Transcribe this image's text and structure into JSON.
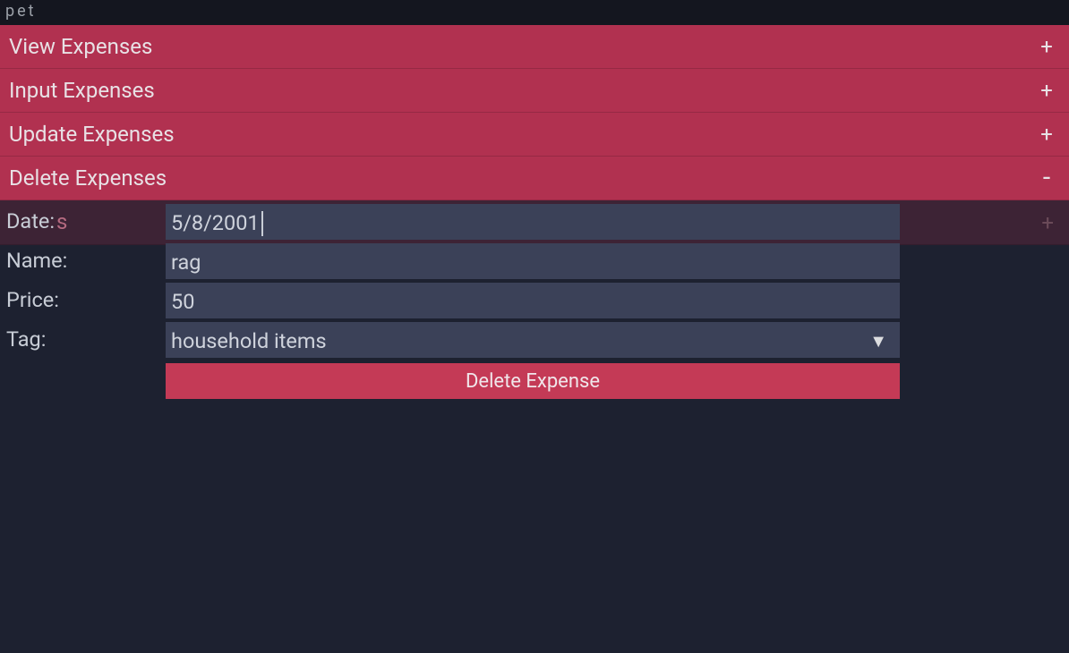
{
  "window": {
    "title": "pet"
  },
  "menu": {
    "items": [
      {
        "label": "View Expenses",
        "toggle": "+",
        "expanded": false
      },
      {
        "label": "Input Expenses",
        "toggle": "+",
        "expanded": false
      },
      {
        "label": "Update Expenses",
        "toggle": "+",
        "expanded": false
      },
      {
        "label": "Delete Expenses",
        "toggle": "-",
        "expanded": true
      }
    ],
    "background_row": {
      "ghost_char": "s",
      "ghost_plus": "+"
    }
  },
  "form": {
    "date": {
      "label": "Date:",
      "value": "5/8/2001"
    },
    "name": {
      "label": "Name:",
      "value": "rag"
    },
    "price": {
      "label": "Price:",
      "value": "50"
    },
    "tag": {
      "label": "Tag:",
      "value": "household items"
    },
    "submit_label": "Delete Expense"
  }
}
